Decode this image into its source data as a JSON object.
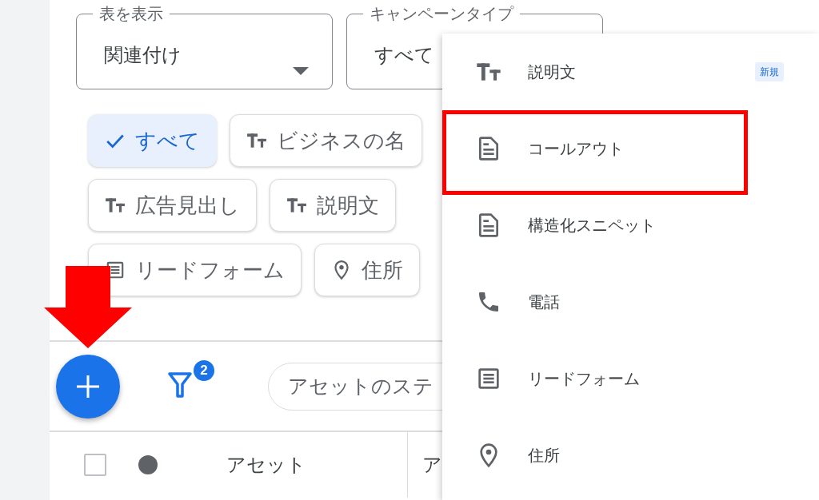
{
  "fields": [
    {
      "label": "表を表示",
      "value": "関連付け",
      "caret": true
    },
    {
      "label": "キャンペーンタイプ",
      "value": "すべて"
    }
  ],
  "chip_rows": [
    [
      {
        "label": "すべて",
        "kind": "check",
        "selected": true
      },
      {
        "label": "ビジネスの名",
        "kind": "text",
        "selected": false
      }
    ],
    [
      {
        "label": "広告見出し",
        "kind": "text",
        "selected": false
      },
      {
        "label": "説明文",
        "kind": "text",
        "selected": false
      }
    ],
    [
      {
        "label": "リードフォーム",
        "kind": "form",
        "selected": false
      },
      {
        "label": "住所",
        "kind": "pin",
        "selected": false
      }
    ]
  ],
  "toolbar": {
    "filter_badge": "2",
    "search": {
      "placeholder": "アセットのステ"
    }
  },
  "table": {
    "checkbox": {
      "checked": false
    },
    "columns": [
      "アセット",
      "ア"
    ]
  },
  "menu": {
    "items": [
      {
        "label": "説明文",
        "kind": "text",
        "badge": "新規"
      },
      {
        "label": "コールアウト",
        "kind": "doc"
      },
      {
        "label": "構造化スニペット",
        "kind": "doc"
      },
      {
        "label": "電話",
        "kind": "phone"
      },
      {
        "label": "リードフォーム",
        "kind": "form"
      },
      {
        "label": "住所",
        "kind": "pin"
      }
    ]
  }
}
